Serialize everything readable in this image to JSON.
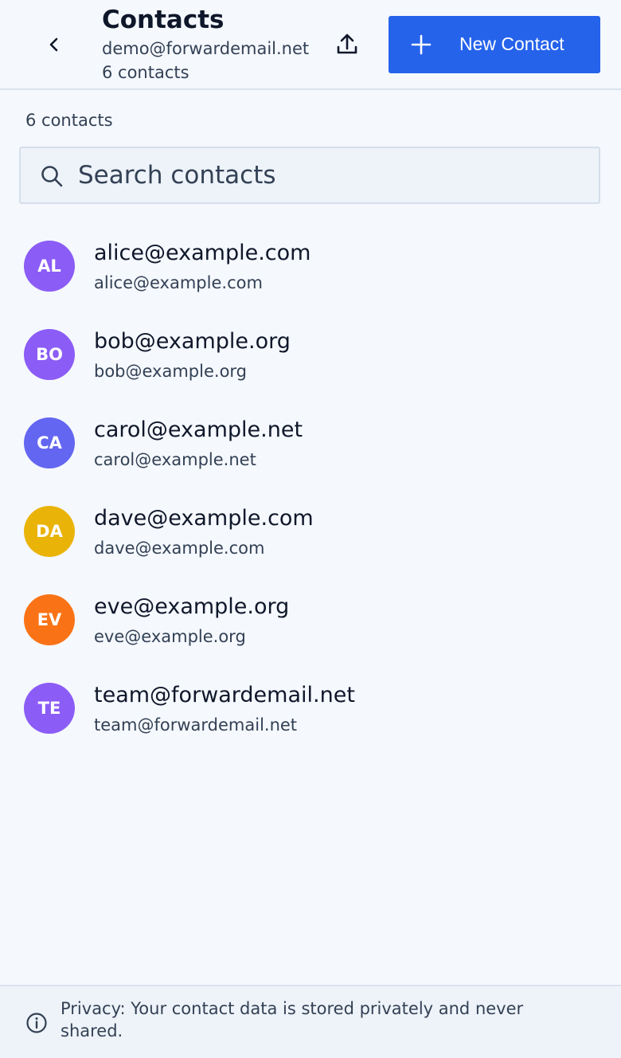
{
  "header": {
    "title": "Contacts",
    "account_email": "demo@forwardemail.net",
    "count_text": "6 contacts",
    "new_contact_label": "New Contact"
  },
  "list": {
    "count_text": "6 contacts"
  },
  "search": {
    "placeholder": "Search contacts",
    "value": ""
  },
  "contacts": [
    {
      "initials": "AL",
      "name": "alice@example.com",
      "email": "alice@example.com",
      "color": "#8b5cf6"
    },
    {
      "initials": "BO",
      "name": "bob@example.org",
      "email": "bob@example.org",
      "color": "#8b5cf6"
    },
    {
      "initials": "CA",
      "name": "carol@example.net",
      "email": "carol@example.net",
      "color": "#6366f1"
    },
    {
      "initials": "DA",
      "name": "dave@example.com",
      "email": "dave@example.com",
      "color": "#eab308"
    },
    {
      "initials": "EV",
      "name": "eve@example.org",
      "email": "eve@example.org",
      "color": "#f97316"
    },
    {
      "initials": "TE",
      "name": "team@forwardemail.net",
      "email": "team@forwardemail.net",
      "color": "#8b5cf6"
    }
  ],
  "footer": {
    "privacy_text": "Privacy: Your contact data is stored privately and never shared."
  },
  "icons": {
    "back": "chevron-left-icon",
    "export": "upload-icon",
    "add": "plus-icon",
    "search": "search-icon",
    "info": "info-icon"
  },
  "colors": {
    "accent": "#2563eb",
    "background": "#f5f8fd",
    "text_primary": "#0f172a",
    "text_secondary": "#334155"
  }
}
